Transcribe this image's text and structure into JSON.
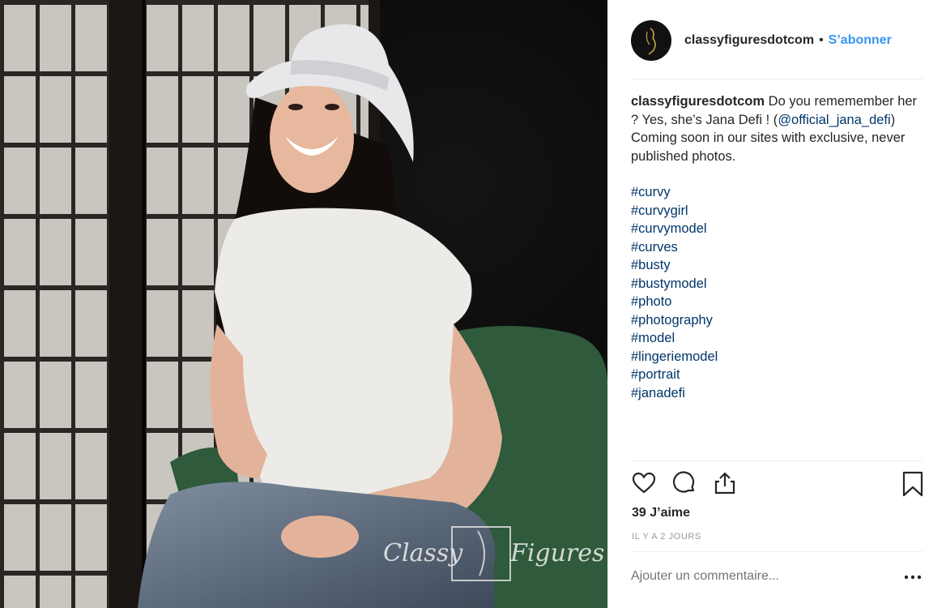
{
  "post": {
    "username": "classyfiguresdotcom",
    "separator": "•",
    "follow_label": "S’abonner",
    "caption": {
      "username": "classyfiguresdotcom",
      "text_before": " Do you rememember her ? Yes, she’s Jana Defi ! (",
      "mention": "@official_jana_defi",
      "text_after": ") Coming soon in our sites with exclusive, never published photos.",
      "hashtags": [
        "#curvy",
        "#curvygirl",
        "#curvymodel",
        "#curves",
        "#busty",
        "#bustymodel",
        "#photo",
        "#photography",
        "#model",
        "#lingeriemodel",
        "#portrait",
        "#janadefi"
      ]
    },
    "likes": "39 J’aime",
    "time_ago": "Il y a 2 jours",
    "comment_placeholder": "Ajouter un commentaire...",
    "watermark": {
      "left": "Classy",
      "right": "Figures"
    }
  },
  "icons": {
    "like": "heart-icon",
    "comment": "comment-bubble-icon",
    "share": "share-icon",
    "save": "bookmark-icon",
    "more": "more-options-icon"
  },
  "colors": {
    "accent": "#3897f0",
    "link": "#003569",
    "muted": "#999999"
  }
}
